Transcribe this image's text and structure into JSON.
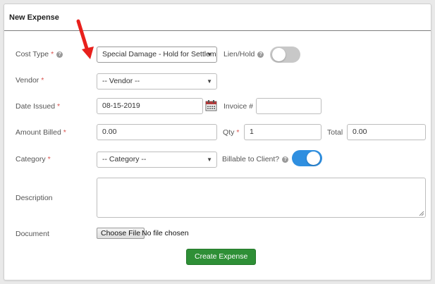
{
  "panel": {
    "title": "New Expense"
  },
  "form": {
    "cost_type": {
      "label": "Cost Type",
      "value": "Special Damage - Hold for Settlem"
    },
    "lien_hold": {
      "label": "Lien/Hold",
      "state": "off"
    },
    "vendor": {
      "label": "Vendor",
      "value": "-- Vendor --"
    },
    "date_issued": {
      "label": "Date Issued",
      "value": "08-15-2019"
    },
    "invoice": {
      "label": "Invoice #",
      "value": ""
    },
    "amount_billed": {
      "label": "Amount Billed",
      "value": "0.00"
    },
    "qty": {
      "label": "Qty",
      "value": "1"
    },
    "total": {
      "label": "Total",
      "value": "0.00"
    },
    "category": {
      "label": "Category",
      "value": "-- Category --"
    },
    "billable": {
      "label": "Billable to Client?",
      "state": "on"
    },
    "description": {
      "label": "Description",
      "value": ""
    },
    "document": {
      "label": "Document",
      "button_label": "Choose File",
      "status": "No file chosen"
    },
    "submit_label": "Create Expense"
  },
  "required_marker": "*",
  "help_glyph": "?",
  "icons": [
    "help-icon",
    "calendar-icon",
    "dropdown-caret-icon",
    "red-arrow-annotation"
  ],
  "colors": {
    "primary_button": "#2e8f36",
    "toggle_on": "#2f8fe0",
    "toggle_off": "#c8c8c8",
    "required": "#d9534f",
    "annotation_arrow": "#e8201c"
  }
}
